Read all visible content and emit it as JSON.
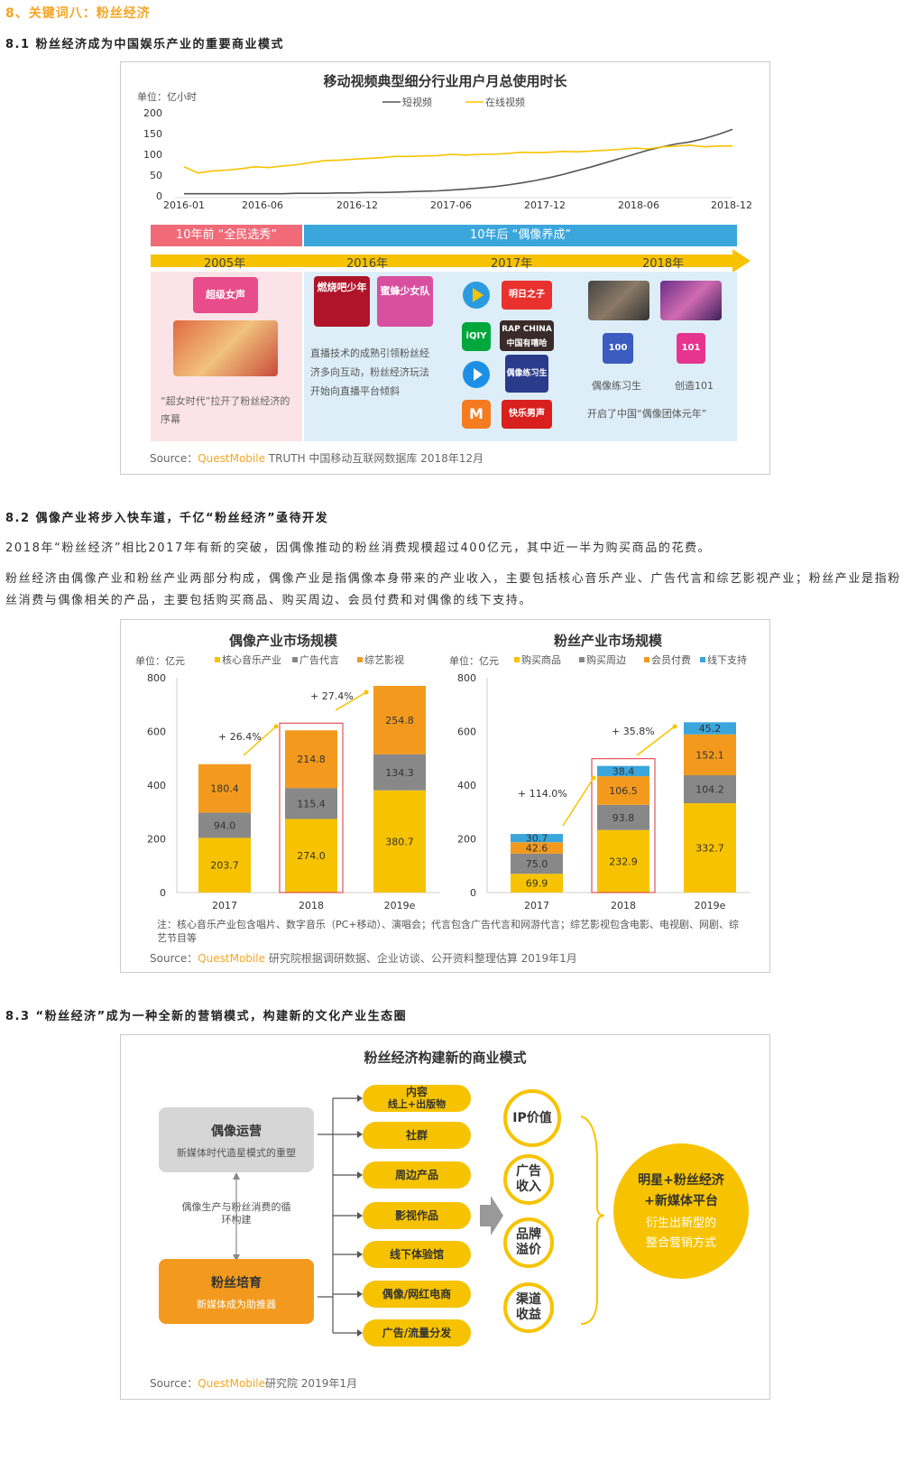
{
  "heading": "8、关键词八：粉丝经济",
  "s81": {
    "title": "8.1  粉丝经济成为中国娱乐产业的重要商业模式",
    "chart_title": "移动视频典型细分行业用户月总使用时长",
    "unit": "单位：亿小时",
    "source_prefix": "Source：",
    "source_brand": "QuestMobile",
    "source_rest": "TRUTH 中国移动互联网数据库 2018年12月",
    "band_left": "10年前 “全民选秀”",
    "band_right": "10年后 “偶像养成”",
    "years": [
      "2005年",
      "2016年",
      "2017年",
      "2018年"
    ],
    "caption_left": "“超女时代”拉开了粉丝经济的序幕",
    "caption_mid": "直播技术的成熟引领粉丝经济多向互动，粉丝经济玩法开始向直播平台倾斜",
    "caption_right": "开启了中国“偶像团体元年”",
    "idol_label1": "偶像练习生",
    "idol_label2": "创造101",
    "logo_texts": [
      "超级女声",
      "燃烧吧少年",
      "蜜蜂少女队",
      "明日之子",
      "RAP CHINA 中国有嘻哈",
      "偶像练习生",
      "快乐男声",
      "100",
      "101"
    ]
  },
  "s82": {
    "title": "8.2  偶像产业将步入快车道，千亿“粉丝经济”亟待开发",
    "p1": "2018年“粉丝经济”相比2017年有新的突破，因偶像推动的粉丝消费规模超过400亿元，其中近一半为购买商品的花费。",
    "p2": "粉丝经济由偶像产业和粉丝产业两部分构成，偶像产业是指偶像本身带来的产业收入，主要包括核心音乐产业、广告代言和综艺影视产业；粉丝产业是指粉丝消费与偶像相关的产品，主要包括购买商品、购买周边、会员付费和对偶像的线下支持。",
    "note": "注：核心音乐产业包含唱片、数字音乐（PC+移动）、演唱会；代言包含广告代言和网游代言；综艺影视包含电影、电视剧、网剧、综艺节目等",
    "source_prefix": "Source：",
    "source_brand": "QuestMobile",
    "source_rest": "研究院根据调研数据、企业访谈、公开资料整理估算 2019年1月"
  },
  "s83": {
    "title": "8.3  “粉丝经济”成为一种全新的营销模式，构建新的文化产业生态圈",
    "diagram_title": "粉丝经济构建新的商业模式",
    "idol_op_title": "偶像运营",
    "idol_op_sub": "新媒体时代造星模式的重塑",
    "cycle_text": "偶像生产与粉丝消费的循环构建",
    "fan_title": "粉丝培育",
    "fan_sub": "新媒体成为助推器",
    "pills": [
      "内容",
      "线上+出版物",
      "社群",
      "周边产品",
      "影视作品",
      "线下体验馆",
      "偶像/网红电商",
      "广告/流量分发"
    ],
    "circles": [
      "IP价值",
      "广告收入",
      "品牌溢价",
      "渠道收益"
    ],
    "result_line1": "明星+粉丝经济",
    "result_line2": "+新媒体平台",
    "result_line3": "衍生出新型的",
    "result_line4": "整合营销方式",
    "source_prefix": "Source：",
    "source_brand": "QuestMobile",
    "source_rest": "研究院 2019年1月"
  },
  "colors": {
    "yellow": "#f7c300",
    "orange": "#f39a1e",
    "gray": "#888888",
    "blue": "#3aa6dc",
    "accent": "#f5a623"
  },
  "chart_data": [
    {
      "type": "line",
      "title": "移动视频典型细分行业用户月总使用时长",
      "ylabel": "单位：亿小时",
      "ylim": [
        0,
        200
      ],
      "yticks": [
        0,
        50,
        100,
        150,
        200
      ],
      "xticks": [
        "2016-01",
        "2016-06",
        "2016-12",
        "2017-06",
        "2017-12",
        "2018-06",
        "2018-12"
      ],
      "legend": "top",
      "series": [
        {
          "name": "短视频",
          "color": "#555555",
          "values": [
            5,
            5,
            5,
            5,
            5,
            5,
            5,
            5,
            6,
            6,
            6,
            7,
            7,
            8,
            8,
            9,
            10,
            11,
            12,
            14,
            16,
            19,
            22,
            26,
            31,
            37,
            44,
            52,
            61,
            70,
            80,
            90,
            100,
            110,
            118,
            125,
            130,
            138,
            148,
            160
          ]
        },
        {
          "name": "在线视频",
          "color": "#f7c300",
          "values": [
            70,
            55,
            60,
            62,
            65,
            70,
            68,
            72,
            75,
            80,
            85,
            86,
            88,
            90,
            92,
            95,
            95,
            96,
            97,
            100,
            98,
            100,
            100,
            102,
            105,
            104,
            105,
            107,
            106,
            108,
            110,
            112,
            115,
            113,
            118,
            120,
            122,
            118,
            120,
            120
          ]
        }
      ]
    },
    {
      "type": "bar",
      "stacked": true,
      "title": "偶像产业市场规模",
      "ylabel": "单位：亿元",
      "ylim": [
        0,
        800
      ],
      "yticks": [
        0,
        200,
        400,
        600,
        800
      ],
      "categories": [
        "2017",
        "2018",
        "2019e"
      ],
      "series": [
        {
          "name": "核心音乐产业",
          "color": "#f7c300",
          "values": [
            203.7,
            274.0,
            380.7
          ]
        },
        {
          "name": "广告代言",
          "color": "#888888",
          "values": [
            94.0,
            115.4,
            134.3
          ]
        },
        {
          "name": "综艺影视",
          "color": "#f39a1e",
          "values": [
            180.4,
            214.8,
            254.8
          ]
        }
      ],
      "growth_labels": [
        "+ 26.4%",
        "+ 27.4%"
      ]
    },
    {
      "type": "bar",
      "stacked": true,
      "title": "粉丝产业市场规模",
      "ylabel": "单位：亿元",
      "ylim": [
        0,
        800
      ],
      "yticks": [
        0,
        200,
        400,
        600,
        800
      ],
      "categories": [
        "2017",
        "2018",
        "2019e"
      ],
      "series": [
        {
          "name": "购买商品",
          "color": "#f7c300",
          "values": [
            69.9,
            232.9,
            332.7
          ]
        },
        {
          "name": "购买周边",
          "color": "#888888",
          "values": [
            75.0,
            93.8,
            104.2
          ]
        },
        {
          "name": "会员付费",
          "color": "#f39a1e",
          "values": [
            42.6,
            106.5,
            152.1
          ]
        },
        {
          "name": "线下支持",
          "color": "#3aa6dc",
          "values": [
            30.7,
            38.4,
            45.2
          ]
        }
      ],
      "growth_labels": [
        "+ 114.0%",
        "+ 35.8%"
      ]
    }
  ]
}
